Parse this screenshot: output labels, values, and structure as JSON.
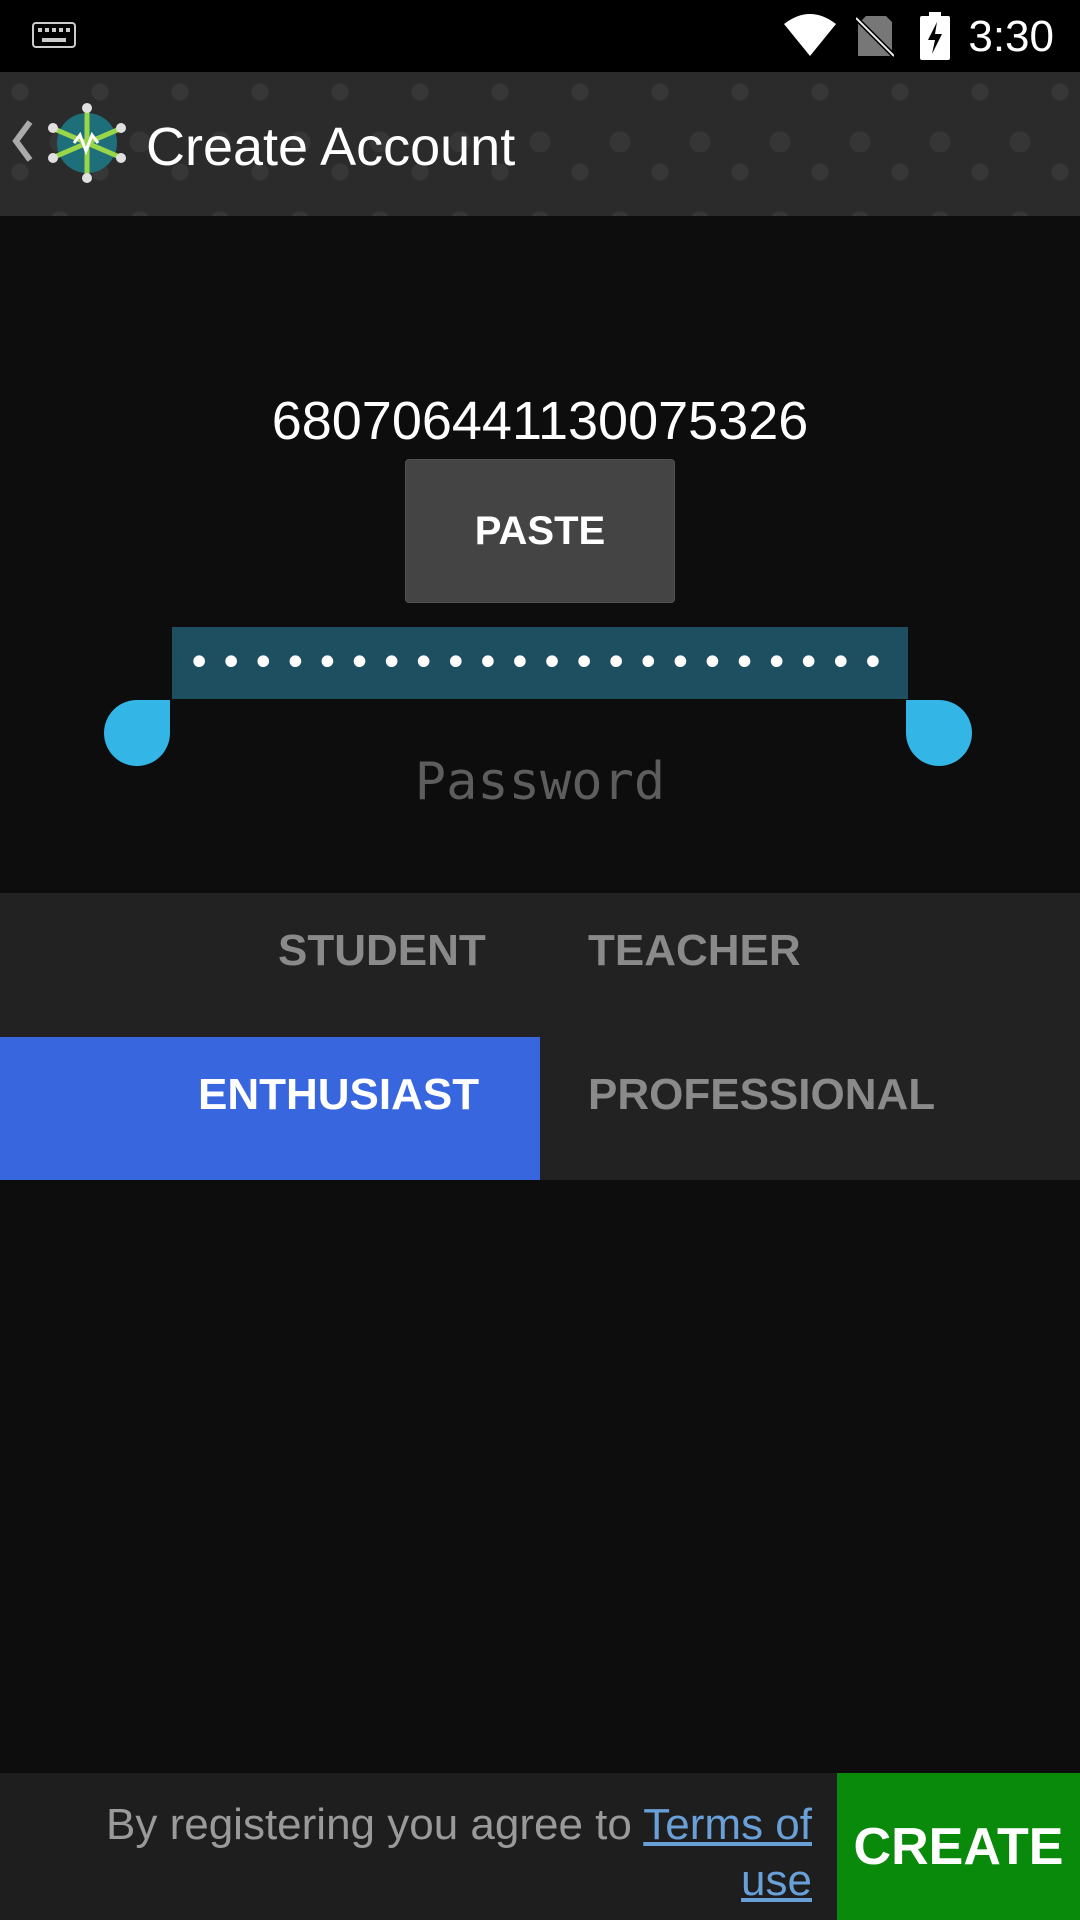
{
  "status_bar": {
    "time": "3:30",
    "icons": [
      "keyboard-icon",
      "wifi-icon",
      "no-sim-icon",
      "battery-charging-icon"
    ]
  },
  "action_bar": {
    "title": "Create Account",
    "icons": [
      "back-chevron-icon",
      "app-logo-icon"
    ]
  },
  "account": {
    "id": "680706441130075326",
    "paste_label": "PASTE"
  },
  "password": {
    "value_masked": "••••••••••••••••••••••",
    "placeholder": "Password"
  },
  "roles": {
    "student": "STUDENT",
    "teacher": "TEACHER",
    "enthusiast": "ENTHUSIAST",
    "professional": "PROFESSIONAL",
    "selected": "ENTHUSIAST"
  },
  "footer": {
    "terms_prefix": "By registering you agree to ",
    "terms_link": "Terms of use",
    "create_label": "CREATE"
  },
  "colors": {
    "accent_selected": "#3766de",
    "create_button": "#0a8a0a",
    "selection_handle": "#33b5e5",
    "password_highlight": "#1e4f60",
    "link": "#6aa0d8"
  }
}
